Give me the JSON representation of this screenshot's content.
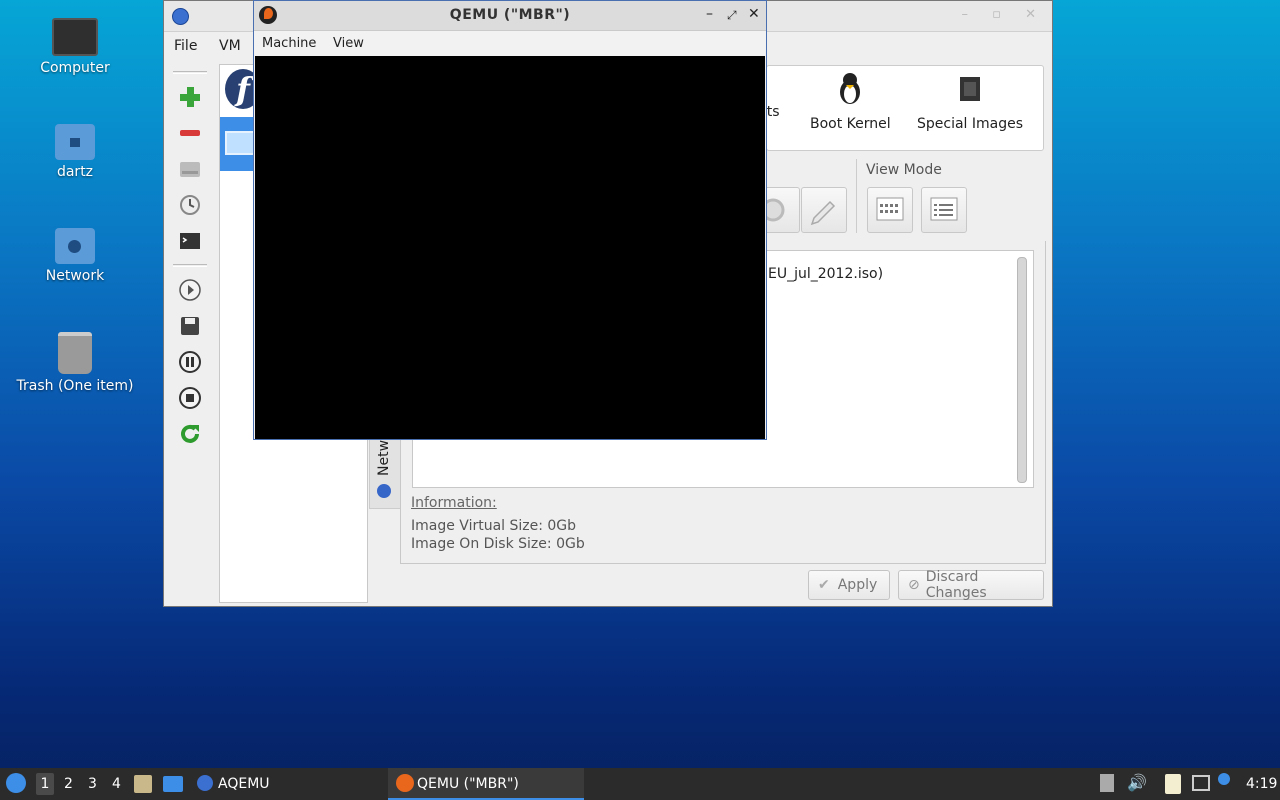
{
  "desktop": {
    "icons": [
      {
        "label": "Computer"
      },
      {
        "label": "dartz"
      },
      {
        "label": "Network"
      },
      {
        "label": "Trash (One item)"
      }
    ]
  },
  "main_window": {
    "menu": {
      "file": "File",
      "vm": "VM"
    },
    "tabs": {
      "partial": "rts",
      "boot_kernel": "Boot Kernel",
      "special_images": "Special Images"
    },
    "view_mode_label": "View Mode",
    "iso_text": "EU_jul_2012.iso)",
    "side_tab_label": "Netw",
    "information": {
      "heading": "Information:",
      "virtual_size": "Image Virtual Size: 0Gb",
      "disk_size": "Image On Disk Size: 0Gb"
    },
    "apply_label": "Apply",
    "discard_label": "Discard Changes"
  },
  "qemu_window": {
    "title": "QEMU (\"MBR\")",
    "menu": {
      "machine": "Machine",
      "view": "View"
    }
  },
  "taskbar": {
    "workspaces": [
      "1",
      "2",
      "3",
      "4"
    ],
    "aqemu_label": "AQEMU",
    "qemu_label": "QEMU (\"MBR\")",
    "clock": "4:19"
  },
  "colors": {
    "accent": "#3d8ee6",
    "taskbar": "#2b2b2b"
  }
}
